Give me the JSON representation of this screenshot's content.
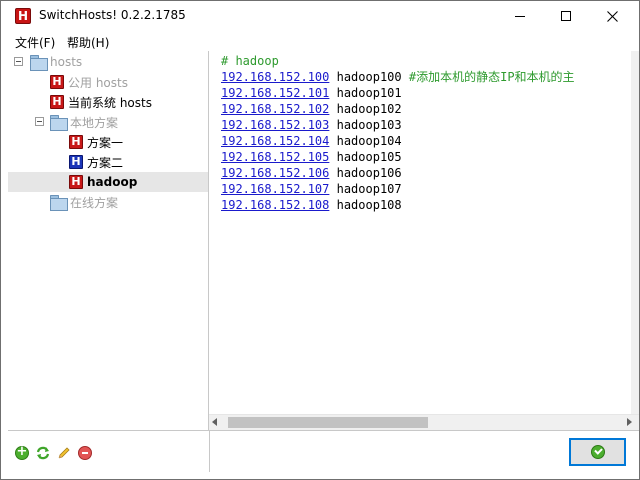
{
  "window": {
    "title": "SwitchHosts! 0.2.2.1785",
    "logo_letter": "H"
  },
  "menu": {
    "file": "文件(F)",
    "help": "帮助(H)"
  },
  "tree": {
    "root": "hosts",
    "public_hosts": "公用 hosts",
    "current_system": "当前系统 hosts",
    "local_group": "本地方案",
    "local_items": [
      {
        "label": "方案一",
        "icon_color": "#c81818"
      },
      {
        "label": "方案二",
        "icon_color": "#1a34b8"
      },
      {
        "label": "hadoop",
        "icon_color": "#c81818",
        "selected": true
      }
    ],
    "online_group": "在线方案"
  },
  "editor": {
    "comment_header": "# hadoop",
    "lines": [
      {
        "ip": "192.168.152.100",
        "host": "hadoop100",
        "comment": "#添加本机的静态IP和本机的主"
      },
      {
        "ip": "192.168.152.101",
        "host": "hadoop101"
      },
      {
        "ip": "192.168.152.102",
        "host": "hadoop102"
      },
      {
        "ip": "192.168.152.103",
        "host": "hadoop103"
      },
      {
        "ip": "192.168.152.104",
        "host": "hadoop104"
      },
      {
        "ip": "192.168.152.105",
        "host": "hadoop105"
      },
      {
        "ip": "192.168.152.106",
        "host": "hadoop106"
      },
      {
        "ip": "192.168.152.107",
        "host": "hadoop107"
      },
      {
        "ip": "192.168.152.108",
        "host": "hadoop108"
      }
    ]
  },
  "toolbar": {
    "icons": [
      "add-icon",
      "refresh-icon",
      "edit-icon",
      "remove-icon"
    ]
  },
  "colors": {
    "comment": "#2e9a2e",
    "ip_link": "#1a1acc",
    "accent": "#0078d7"
  }
}
